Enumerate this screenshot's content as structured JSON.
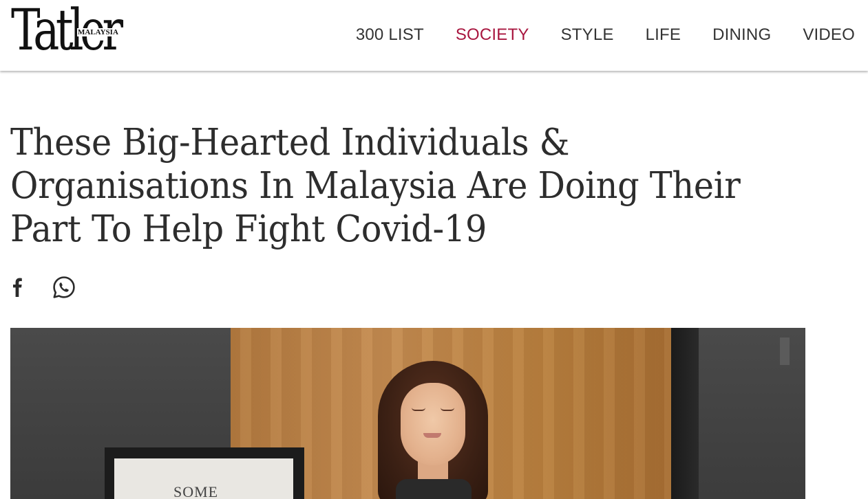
{
  "header": {
    "logo": {
      "word": "Tatler",
      "region": "MALAYSIA"
    },
    "nav": [
      {
        "label": "300 LIST",
        "active": false
      },
      {
        "label": "SOCIETY",
        "active": true
      },
      {
        "label": "STYLE",
        "active": false
      },
      {
        "label": "LIFE",
        "active": false
      },
      {
        "label": "DINING",
        "active": false
      },
      {
        "label": "VIDEO",
        "active": false
      }
    ]
  },
  "article": {
    "title": "These Big-Hearted Individuals & Organisations In Malaysia Are Doing Their Part To Help Fight Covid-19",
    "share": [
      {
        "icon": "facebook-icon"
      },
      {
        "icon": "whatsapp-icon"
      }
    ],
    "hero_frame_text": "SOME"
  },
  "colors": {
    "accent": "#a8163f",
    "text": "#2d2d2d",
    "nav": "#333333"
  }
}
